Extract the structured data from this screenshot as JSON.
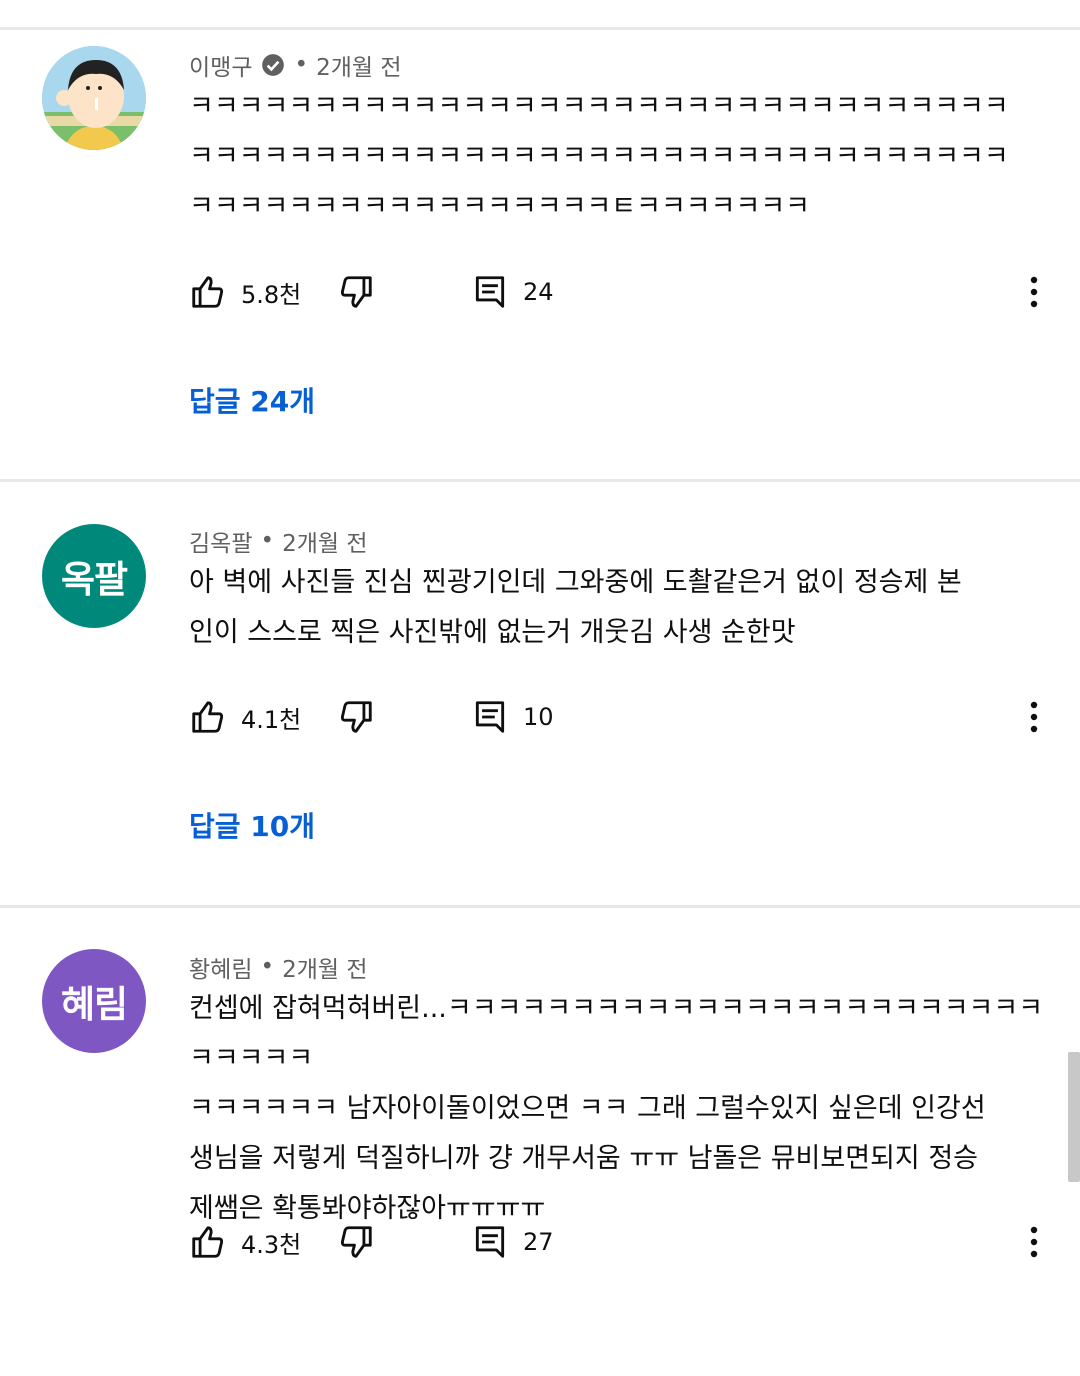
{
  "comments": [
    {
      "author": "이맹구",
      "verified": true,
      "separator": "•",
      "time": "2개월 전",
      "text": "ㅋㅋㅋㅋㅋㅋㅋㅋㅋㅋㅋㅋㅋㅋㅋㅋㅋㅋㅋㅋㅋㅋㅋㅋㅋㅋㅋㅋㅋㅋㅋㅋㅋ\nㅋㅋㅋㅋㅋㅋㅋㅋㅋㅋㅋㅋㅋㅋㅋㅋㅋㅋㅋㅋㅋㅋㅋㅋㅋㅋㅋㅋㅋㅋㅋㅋㅋ\nㅋㅋㅋㅋㅋㅋㅋㅋㅋㅋㅋㅋㅋㅋㅋㅋㅋㅌㅋㅋㅋㅋㅋㅋㅋ",
      "likes": "5.8천",
      "reply_count": "24",
      "replies_label": "답글 24개",
      "avatar": {
        "type": "image",
        "name": "cartoon-avatar"
      }
    },
    {
      "author": "김옥팔",
      "verified": false,
      "separator": "•",
      "time": "2개월 전",
      "text": "아 벽에 사진들 진심 찐광기인데 그와중에 도촬같은거 없이 정승제 본\n인이 스스로 찍은 사진밖에 없는거 개웃김 사생 순한맛",
      "likes": "4.1천",
      "reply_count": "10",
      "replies_label": "답글 10개",
      "avatar": {
        "type": "text",
        "text": "옥팔",
        "color": "#00897b"
      }
    },
    {
      "author": "황혜림",
      "verified": false,
      "separator": "•",
      "time": "2개월 전",
      "text": "컨셉에 잡혀먹혀버린...ㅋㅋㅋㅋㅋㅋㅋㅋㅋㅋㅋㅋㅋㅋㅋㅋㅋㅋㅋㅋㅋㅋㅋㅋㅋㅋㅋㅋㅋ\nㅋㅋㅋㅋㅋㅋ 남자아이돌이었으면 ㅋㅋ 그래 그럴수있지 싶은데 인강선\n생님을 저렇게 덕질하니까 걍 개무서움 ㅠㅠ 남돌은 뮤비보면되지 정승\n제쌤은 확통봐야하잖아ㅠㅠㅠㅠ",
      "likes": "4.3천",
      "reply_count": "27",
      "replies_label": "",
      "avatar": {
        "type": "text",
        "text": "혜림",
        "color": "#7e57c2"
      }
    }
  ],
  "icons": {
    "like": "thumb-up-icon",
    "dislike": "thumb-down-icon",
    "reply": "comment-icon",
    "more": "more-vert-icon",
    "verified": "verified-check-icon"
  },
  "colors": {
    "replies_link": "#065fd4",
    "meta_text": "#606060",
    "divider": "#e8e8e8"
  }
}
